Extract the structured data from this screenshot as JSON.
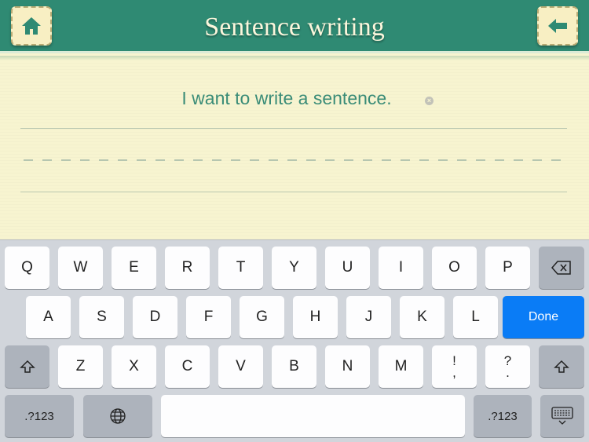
{
  "header": {
    "title": "Sentence writing",
    "home_icon": "home-icon",
    "back_icon": "arrow-left-icon",
    "color": "#2f8a73"
  },
  "paper": {
    "sentence": "I want to write a sentence.",
    "clear_icon": "clear-icon",
    "text_color": "#3a8c77"
  },
  "keyboard": {
    "row1": [
      "Q",
      "W",
      "E",
      "R",
      "T",
      "Y",
      "U",
      "I",
      "O",
      "P"
    ],
    "row2": [
      "A",
      "S",
      "D",
      "F",
      "G",
      "H",
      "J",
      "K",
      "L"
    ],
    "row3": [
      "Z",
      "X",
      "C",
      "V",
      "B",
      "N",
      "M"
    ],
    "punct1": {
      "top": "!",
      "bottom": ","
    },
    "punct2": {
      "top": "?",
      "bottom": "."
    },
    "done_label": "Done",
    "numbers_label": ".?123",
    "done_color": "#0a7cf6"
  }
}
